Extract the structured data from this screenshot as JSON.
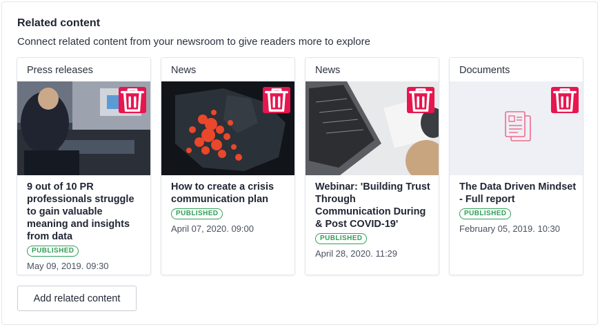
{
  "section": {
    "title": "Related content",
    "subtitle": "Connect related content from your newsroom to give readers more to explore"
  },
  "cards": [
    {
      "type": "Press releases",
      "title": "9 out of 10 PR professionals struggle to gain valuable meaning and insights from data",
      "status": "PUBLISHED",
      "date": "May 09, 2019. 09:30"
    },
    {
      "type": "News",
      "title": "How to create a crisis communication plan",
      "status": "PUBLISHED",
      "date": "April 07, 2020. 09:00"
    },
    {
      "type": "News",
      "title": "Webinar: 'Building Trust Through Communication During & Post COVID-19'",
      "status": "PUBLISHED",
      "date": "April 28, 2020. 11:29"
    },
    {
      "type": "Documents",
      "title": "The Data Driven Mindset - Full report",
      "status": "PUBLISHED",
      "date": "February 05, 2019. 10:30"
    }
  ],
  "icons": {
    "delete": "trash-icon",
    "document": "document-icon"
  },
  "colors": {
    "accent": "#e8154f",
    "published": "#2f9e57"
  },
  "actions": {
    "add_label": "Add related content"
  }
}
